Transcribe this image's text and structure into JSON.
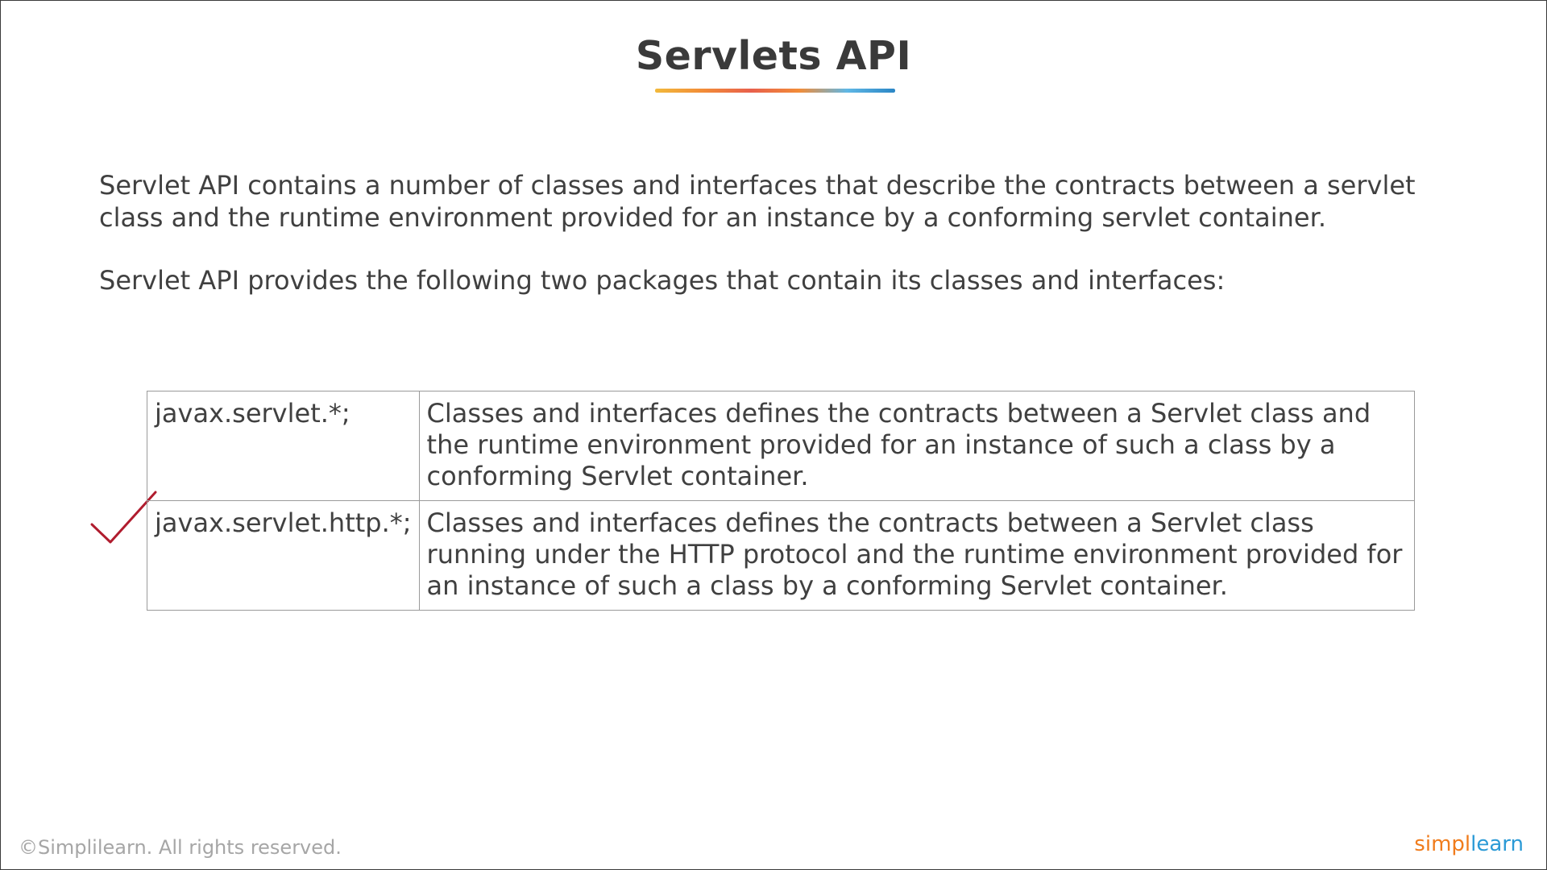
{
  "title": "Servlets API",
  "underline_colors": [
    "#f2b93b",
    "#f28c38",
    "#e8604c",
    "#f28c38",
    "#5fb7e5",
    "#2b86c5"
  ],
  "paragraphs": [
    "Servlet API contains a number of classes and interfaces that describe the contracts between a servlet class and the runtime environment provided for an instance by a conforming servlet container.",
    "Servlet API provides the following two packages that contain its classes and interfaces:"
  ],
  "table": {
    "rows": [
      {
        "package": "javax.servlet.*;",
        "description": "Classes and interfaces defines the contracts between a Servlet class and the runtime environment provided for an instance of such a class by a conforming Servlet container."
      },
      {
        "package": "javax.servlet.http.*;",
        "description": "Classes and interfaces defines the contracts between a Servlet class running under the HTTP protocol and the runtime environment provided for an instance of such a class by a conforming Servlet container."
      }
    ]
  },
  "annotation": {
    "icon": "checkmark-icon",
    "color": "#b01c2e",
    "marked_row": 2
  },
  "footer": {
    "copyright": "©Simplilearn. All rights reserved.",
    "logo_part1": "simpl",
    "logo_part2": "learn",
    "logo_color1": "#f07c1c",
    "logo_color2": "#2b9ad6"
  }
}
